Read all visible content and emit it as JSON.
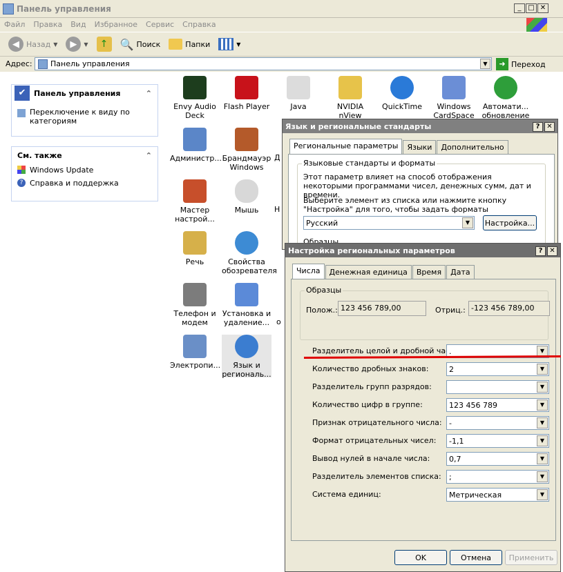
{
  "window": {
    "title": "Панель управления"
  },
  "menu": [
    "Файл",
    "Правка",
    "Вид",
    "Избранное",
    "Сервис",
    "Справка"
  ],
  "toolbar": {
    "back": "Назад",
    "search": "Поиск",
    "folders": "Папки"
  },
  "address": {
    "label": "Адрес:",
    "value": "Панель управления",
    "go": "Переход"
  },
  "sidebar": {
    "panel_title": "Панель управления",
    "switch_view": "Переключение к виду по категориям",
    "see_also_title": "См. также",
    "see_also": [
      "Windows Update",
      "Справка и поддержка"
    ]
  },
  "icons": [
    {
      "label": "Envy Audio Deck",
      "color": "#1d3d1d"
    },
    {
      "label": "Flash Player",
      "color": "#c8121a"
    },
    {
      "label": "Java",
      "color": "#dcdcdc"
    },
    {
      "label": "NVIDIA nView Desktop M...",
      "color": "#e7c34a"
    },
    {
      "label": "QuickTime",
      "color": "#2a7ad8"
    },
    {
      "label": "Windows CardSpace",
      "color": "#6b8ed6"
    },
    {
      "label": "Автомати... обновление",
      "color": "#2e9e3a"
    },
    {
      "label": "Администр...",
      "color": "#5b86c8"
    },
    {
      "label": "Брандмауэр Windows",
      "color": "#b45a2a"
    },
    {
      "label": "Мастер настрой...",
      "color": "#c74f2b"
    },
    {
      "label": "Мышь",
      "color": "#d8d8d8"
    },
    {
      "label": "Речь",
      "color": "#d6b04a"
    },
    {
      "label": "Свойства обозревателя",
      "color": "#3d8bd4"
    },
    {
      "label": "Телефон и модем",
      "color": "#7c7c7c"
    },
    {
      "label": "Установка и удаление...",
      "color": "#5b8ad8"
    },
    {
      "label": "Электропи...",
      "color": "#6a8fc7"
    },
    {
      "label": "Язык и региональ...",
      "color": "#3b7dd0"
    }
  ],
  "partial": [
    "Д",
    "Н",
    "о"
  ],
  "dlg1": {
    "title": "Язык и региональные стандарты",
    "tabs": [
      "Региональные параметры",
      "Языки",
      "Дополнительно"
    ],
    "group": "Языковые стандарты и форматы",
    "desc1": "Этот параметр влияет на способ отображения некоторыми программами чисел, денежных сумм, дат и времени.",
    "desc2": "Выберите элемент из списка или нажмите кнопку \"Настройка\" для того, чтобы задать форматы самостоятельно:",
    "locale": "Русский",
    "settings_btn": "Настройка...",
    "samples": "Образцы"
  },
  "dlg2": {
    "title": "Настройка региональных параметров",
    "tabs": [
      "Числа",
      "Денежная единица",
      "Время",
      "Дата"
    ],
    "samples_label": "Образцы",
    "pos_label": "Полож.:",
    "pos_value": "123 456 789,00",
    "neg_label": "Отриц.:",
    "neg_value": "-123 456 789,00",
    "rows": [
      {
        "label": "Разделитель целой и дробной части:",
        "value": "."
      },
      {
        "label": "Количество дробных знаков:",
        "value": "2"
      },
      {
        "label": "Разделитель групп разрядов:",
        "value": ""
      },
      {
        "label": "Количество цифр в группе:",
        "value": "123 456 789"
      },
      {
        "label": "Признак отрицательного числа:",
        "value": "-"
      },
      {
        "label": "Формат отрицательных чисел:",
        "value": "-1,1"
      },
      {
        "label": "Вывод нулей в начале числа:",
        "value": "0,7"
      },
      {
        "label": "Разделитель элементов списка:",
        "value": ";"
      },
      {
        "label": "Система единиц:",
        "value": "Метрическая"
      }
    ],
    "ok": "OK",
    "cancel": "Отмена",
    "apply": "Применить"
  },
  "colors": {
    "accent_line": "#e00000"
  }
}
